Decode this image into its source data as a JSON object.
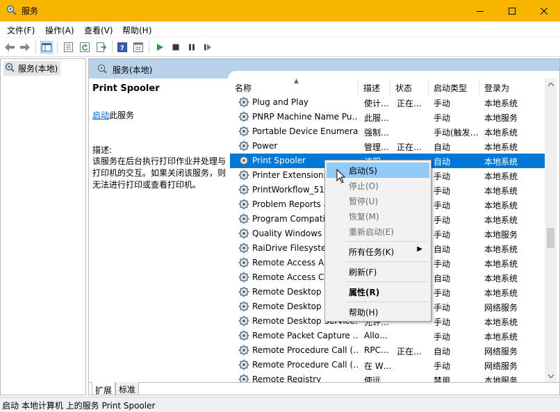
{
  "window": {
    "title": "服务"
  },
  "menu": [
    "文件(F)",
    "操作(A)",
    "查看(V)",
    "帮助(H)"
  ],
  "tree": {
    "item": "服务(本地)"
  },
  "header": {
    "title": "服务(本地)"
  },
  "detail": {
    "name": "Print Spooler",
    "start_link": "启动",
    "start_suffix": "此服务",
    "desc_label": "描述:",
    "desc_text": "该服务在后台执行打印作业并处理与打印机的交互。如果关闭该服务，则无法进行打印或查看打印机。"
  },
  "columns": {
    "name": "名称",
    "desc": "描述",
    "status": "状态",
    "start": "启动类型",
    "logon": "登录为"
  },
  "rows": [
    {
      "name": "Plug and Play",
      "desc": "使计…",
      "status": "正在…",
      "start": "手动",
      "logon": "本地系统"
    },
    {
      "name": "PNRP Machine Name Pu…",
      "desc": "此服…",
      "status": "",
      "start": "手动",
      "logon": "本地服务"
    },
    {
      "name": "Portable Device Enumera…",
      "desc": "强制…",
      "status": "",
      "start": "手动(触发…",
      "logon": "本地系统"
    },
    {
      "name": "Power",
      "desc": "管理…",
      "status": "正在…",
      "start": "自动",
      "logon": "本地系统"
    },
    {
      "name": "Print Spooler",
      "desc": "该服…",
      "status": "",
      "start": "自动",
      "logon": "本地系统"
    },
    {
      "name": "Printer Extensions",
      "desc": "",
      "status": "",
      "start": "手动",
      "logon": "本地系统"
    },
    {
      "name": "PrintWorkflow_517",
      "desc": "",
      "status": "",
      "start": "手动",
      "logon": "本地系统"
    },
    {
      "name": "Problem Reports a",
      "desc": "",
      "status": "",
      "start": "手动",
      "logon": "本地系统"
    },
    {
      "name": "Program Compati",
      "desc": "",
      "status": "",
      "start": "手动",
      "logon": "本地系统"
    },
    {
      "name": "Quality Windows A",
      "desc": "",
      "status": "",
      "start": "手动",
      "logon": "本地服务"
    },
    {
      "name": "RaiDrive Filesyster",
      "desc": "",
      "status": "",
      "start": "自动",
      "logon": "本地系统"
    },
    {
      "name": "Remote Access Au",
      "desc": "",
      "status": "",
      "start": "手动",
      "logon": "本地系统"
    },
    {
      "name": "Remote Access Co",
      "desc": "",
      "status": "",
      "start": "自动",
      "logon": "本地系统"
    },
    {
      "name": "Remote Desktop C",
      "desc": "",
      "status": "",
      "start": "手动",
      "logon": "本地系统"
    },
    {
      "name": "Remote Desktop S",
      "desc": "",
      "status": "",
      "start": "手动",
      "logon": "网络服务"
    },
    {
      "name": "Remote Desktop Service…",
      "desc": "允许…",
      "status": "",
      "start": "手动",
      "logon": "本地系统"
    },
    {
      "name": "Remote Packet Capture …",
      "desc": "Allo…",
      "status": "",
      "start": "手动",
      "logon": "本地系统"
    },
    {
      "name": "Remote Procedure Call (…",
      "desc": "RPC…",
      "status": "正在…",
      "start": "自动",
      "logon": "网络服务"
    },
    {
      "name": "Remote Procedure Call (…",
      "desc": "在 W…",
      "status": "",
      "start": "手动",
      "logon": "网络服务"
    },
    {
      "name": "Remote Registry",
      "desc": "使远…",
      "status": "",
      "start": "禁用",
      "logon": "本地服务"
    }
  ],
  "context_menu": {
    "start": "启动(S)",
    "stop": "停止(O)",
    "pause": "暂停(U)",
    "resume": "恢复(M)",
    "restart": "重新启动(E)",
    "all_tasks": "所有任务(K)",
    "refresh": "刷新(F)",
    "properties": "属性(R)",
    "help": "帮助(H)"
  },
  "tabs": [
    "扩展",
    "标准"
  ],
  "status": {
    "text": "启动 本地计算机 上的服务 Print Spooler"
  },
  "colors": {
    "titlebar": "#f7b500",
    "selection": "#0078d7",
    "menu_highlight": "#91c9f7",
    "pane_header": "#b8d2ec"
  }
}
